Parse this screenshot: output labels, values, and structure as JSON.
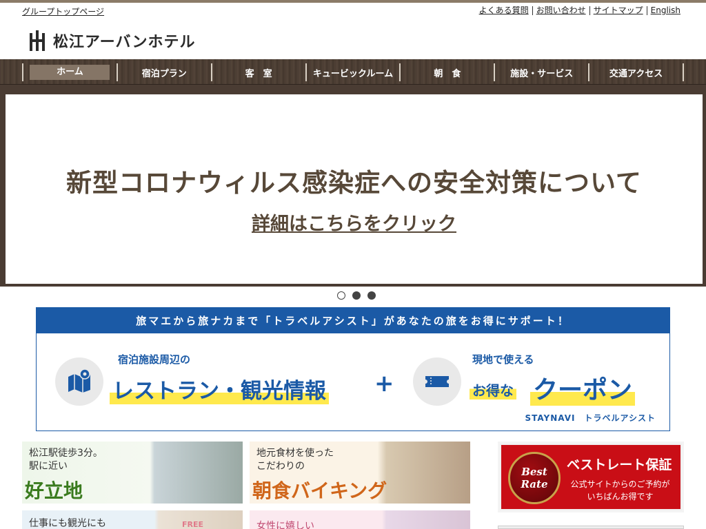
{
  "header": {
    "group_link": "グループトップページ",
    "util_links": [
      "よくある質問",
      "お問い合わせ",
      "サイトマップ",
      "English"
    ],
    "logo_text": "松江アーバンホテル"
  },
  "nav": {
    "items": [
      "ホーム",
      "宿泊プラン",
      "客　室",
      "キュービックルーム",
      "朝　食",
      "施設・サービス",
      "交通アクセス"
    ],
    "active_index": 0
  },
  "hero": {
    "title": "新型コロナウィルス感染症への安全対策について",
    "link": "詳細はこちらをクリック",
    "slides": 3,
    "active_slide": 1
  },
  "banner": {
    "headline": "旅マエから旅ナカまで「トラベルアシスト」があなたの旅をお得にサポート！",
    "left_small": "宿泊施設周辺の",
    "left_big": "レストラン・観光情報",
    "plus": "+",
    "right_small": "現地で使える",
    "right_big_prefix": "お得な",
    "right_big": "クーポン",
    "footer": "STAYNAVI　トラベルアシスト",
    "left_icon": "map-icon",
    "right_icon": "ticket-icon"
  },
  "cards": [
    {
      "text1": "松江駅徒歩3分。",
      "text2": "駅に近い",
      "big": "好立地"
    },
    {
      "text1": "地元食材を使った",
      "text2": "こだわりの",
      "big": "朝食バイキング"
    },
    {
      "text1": "仕事にも観光にも",
      "text2": "",
      "big": ""
    },
    {
      "text1": "女性に嬉しい",
      "text2": "",
      "big": ""
    }
  ],
  "card_badge": "FREE",
  "best_rate": {
    "badge_line1": "Best",
    "badge_line2": "Rate",
    "title": "ベストレート保証",
    "sub1": "公式サイトからのご予約が",
    "sub2": "いちばんお得です"
  },
  "colors": {
    "nav_bg": "#4a3c33",
    "hero_text": "#574838",
    "banner_blue": "#1b5aa6",
    "highlight_yellow": "#ffe94d",
    "best_rate_red": "#c90e16"
  }
}
